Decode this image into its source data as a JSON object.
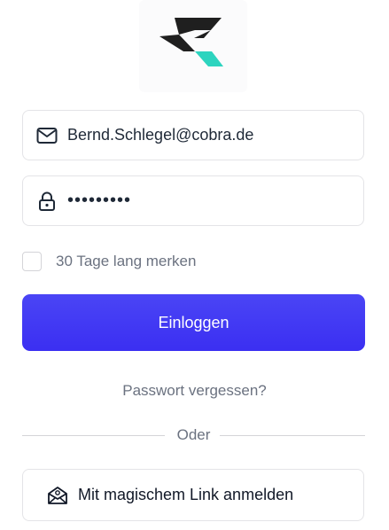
{
  "logo": {
    "name": "app-logo",
    "colors": [
      "#1f1f1f",
      "#2dd4bf"
    ]
  },
  "email_field": {
    "value": "Bernd.Schlegel@cobra.de",
    "icon": "mail-icon"
  },
  "password_field": {
    "value": "•••••••••",
    "icon": "lock-icon"
  },
  "remember": {
    "label": "30 Tage lang merken",
    "checked": false
  },
  "login_button": {
    "label": "Einloggen",
    "color": "#3f3af4"
  },
  "forgot_link": {
    "label": "Passwort vergessen?"
  },
  "divider": {
    "label": "Oder"
  },
  "magic_link_button": {
    "label": "Mit magischem Link anmelden",
    "icon": "mail-open-icon"
  }
}
